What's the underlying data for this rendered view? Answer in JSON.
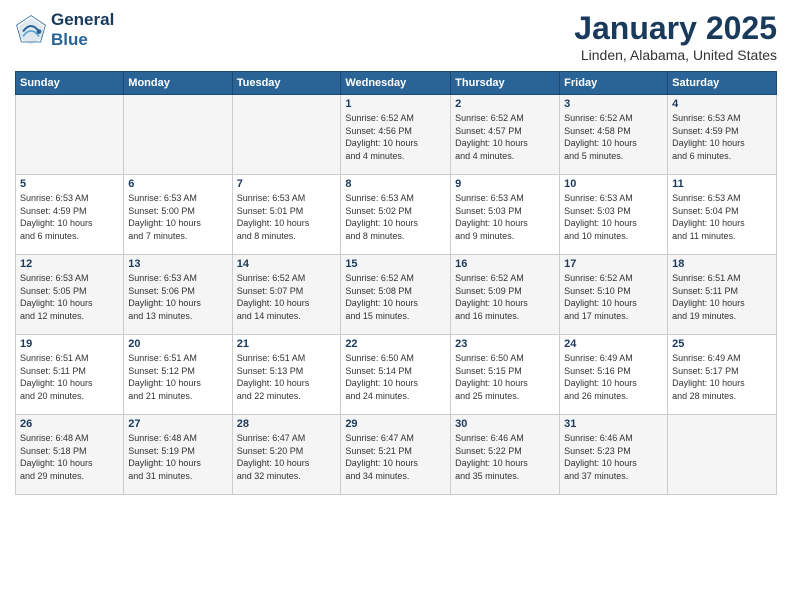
{
  "header": {
    "logo_line1": "General",
    "logo_line2": "Blue",
    "month_title": "January 2025",
    "location": "Linden, Alabama, United States"
  },
  "weekdays": [
    "Sunday",
    "Monday",
    "Tuesday",
    "Wednesday",
    "Thursday",
    "Friday",
    "Saturday"
  ],
  "weeks": [
    [
      {
        "day": "",
        "info": ""
      },
      {
        "day": "",
        "info": ""
      },
      {
        "day": "",
        "info": ""
      },
      {
        "day": "1",
        "info": "Sunrise: 6:52 AM\nSunset: 4:56 PM\nDaylight: 10 hours\nand 4 minutes."
      },
      {
        "day": "2",
        "info": "Sunrise: 6:52 AM\nSunset: 4:57 PM\nDaylight: 10 hours\nand 4 minutes."
      },
      {
        "day": "3",
        "info": "Sunrise: 6:52 AM\nSunset: 4:58 PM\nDaylight: 10 hours\nand 5 minutes."
      },
      {
        "day": "4",
        "info": "Sunrise: 6:53 AM\nSunset: 4:59 PM\nDaylight: 10 hours\nand 6 minutes."
      }
    ],
    [
      {
        "day": "5",
        "info": "Sunrise: 6:53 AM\nSunset: 4:59 PM\nDaylight: 10 hours\nand 6 minutes."
      },
      {
        "day": "6",
        "info": "Sunrise: 6:53 AM\nSunset: 5:00 PM\nDaylight: 10 hours\nand 7 minutes."
      },
      {
        "day": "7",
        "info": "Sunrise: 6:53 AM\nSunset: 5:01 PM\nDaylight: 10 hours\nand 8 minutes."
      },
      {
        "day": "8",
        "info": "Sunrise: 6:53 AM\nSunset: 5:02 PM\nDaylight: 10 hours\nand 8 minutes."
      },
      {
        "day": "9",
        "info": "Sunrise: 6:53 AM\nSunset: 5:03 PM\nDaylight: 10 hours\nand 9 minutes."
      },
      {
        "day": "10",
        "info": "Sunrise: 6:53 AM\nSunset: 5:03 PM\nDaylight: 10 hours\nand 10 minutes."
      },
      {
        "day": "11",
        "info": "Sunrise: 6:53 AM\nSunset: 5:04 PM\nDaylight: 10 hours\nand 11 minutes."
      }
    ],
    [
      {
        "day": "12",
        "info": "Sunrise: 6:53 AM\nSunset: 5:05 PM\nDaylight: 10 hours\nand 12 minutes."
      },
      {
        "day": "13",
        "info": "Sunrise: 6:53 AM\nSunset: 5:06 PM\nDaylight: 10 hours\nand 13 minutes."
      },
      {
        "day": "14",
        "info": "Sunrise: 6:52 AM\nSunset: 5:07 PM\nDaylight: 10 hours\nand 14 minutes."
      },
      {
        "day": "15",
        "info": "Sunrise: 6:52 AM\nSunset: 5:08 PM\nDaylight: 10 hours\nand 15 minutes."
      },
      {
        "day": "16",
        "info": "Sunrise: 6:52 AM\nSunset: 5:09 PM\nDaylight: 10 hours\nand 16 minutes."
      },
      {
        "day": "17",
        "info": "Sunrise: 6:52 AM\nSunset: 5:10 PM\nDaylight: 10 hours\nand 17 minutes."
      },
      {
        "day": "18",
        "info": "Sunrise: 6:51 AM\nSunset: 5:11 PM\nDaylight: 10 hours\nand 19 minutes."
      }
    ],
    [
      {
        "day": "19",
        "info": "Sunrise: 6:51 AM\nSunset: 5:11 PM\nDaylight: 10 hours\nand 20 minutes."
      },
      {
        "day": "20",
        "info": "Sunrise: 6:51 AM\nSunset: 5:12 PM\nDaylight: 10 hours\nand 21 minutes."
      },
      {
        "day": "21",
        "info": "Sunrise: 6:51 AM\nSunset: 5:13 PM\nDaylight: 10 hours\nand 22 minutes."
      },
      {
        "day": "22",
        "info": "Sunrise: 6:50 AM\nSunset: 5:14 PM\nDaylight: 10 hours\nand 24 minutes."
      },
      {
        "day": "23",
        "info": "Sunrise: 6:50 AM\nSunset: 5:15 PM\nDaylight: 10 hours\nand 25 minutes."
      },
      {
        "day": "24",
        "info": "Sunrise: 6:49 AM\nSunset: 5:16 PM\nDaylight: 10 hours\nand 26 minutes."
      },
      {
        "day": "25",
        "info": "Sunrise: 6:49 AM\nSunset: 5:17 PM\nDaylight: 10 hours\nand 28 minutes."
      }
    ],
    [
      {
        "day": "26",
        "info": "Sunrise: 6:48 AM\nSunset: 5:18 PM\nDaylight: 10 hours\nand 29 minutes."
      },
      {
        "day": "27",
        "info": "Sunrise: 6:48 AM\nSunset: 5:19 PM\nDaylight: 10 hours\nand 31 minutes."
      },
      {
        "day": "28",
        "info": "Sunrise: 6:47 AM\nSunset: 5:20 PM\nDaylight: 10 hours\nand 32 minutes."
      },
      {
        "day": "29",
        "info": "Sunrise: 6:47 AM\nSunset: 5:21 PM\nDaylight: 10 hours\nand 34 minutes."
      },
      {
        "day": "30",
        "info": "Sunrise: 6:46 AM\nSunset: 5:22 PM\nDaylight: 10 hours\nand 35 minutes."
      },
      {
        "day": "31",
        "info": "Sunrise: 6:46 AM\nSunset: 5:23 PM\nDaylight: 10 hours\nand 37 minutes."
      },
      {
        "day": "",
        "info": ""
      }
    ]
  ]
}
